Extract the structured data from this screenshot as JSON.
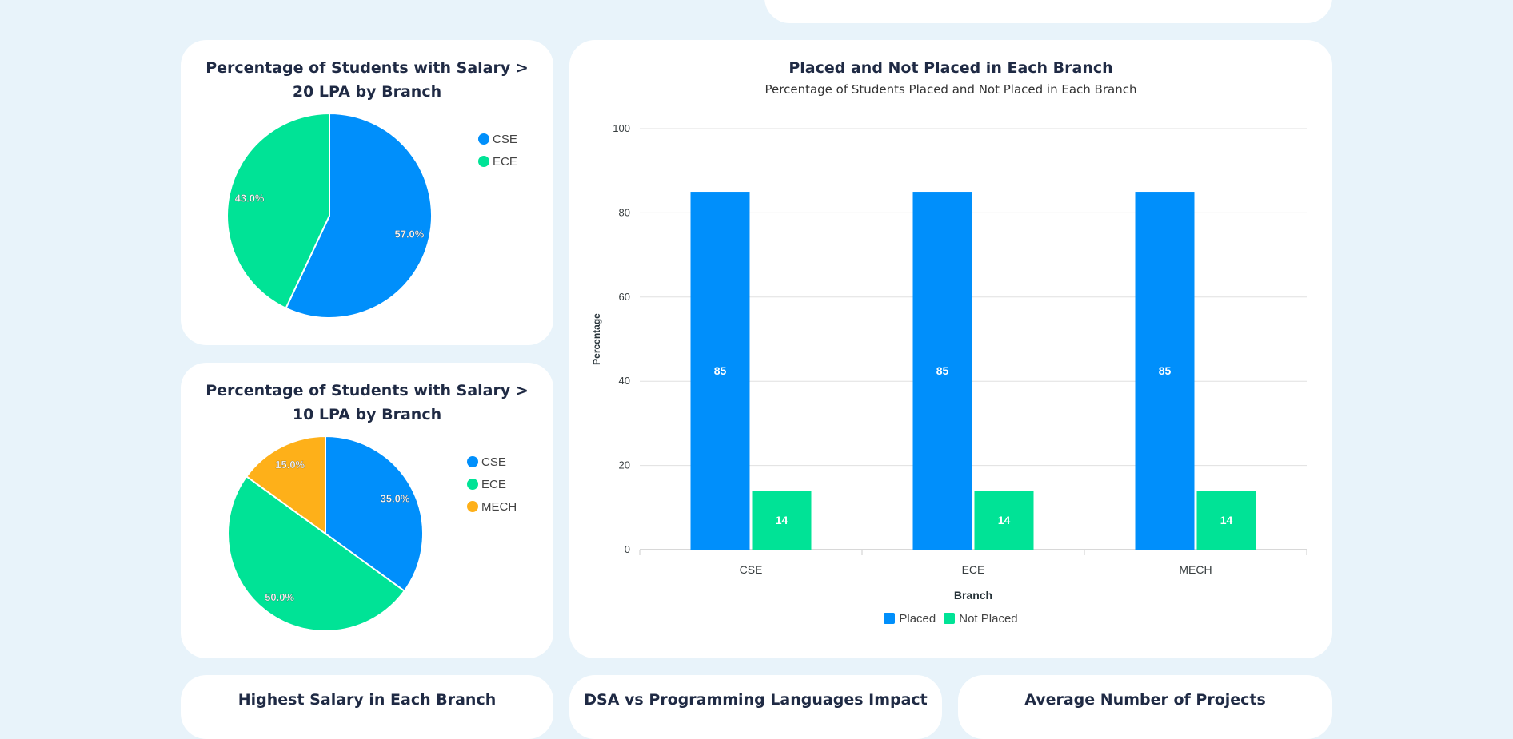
{
  "colors": {
    "blue": "#008ffb",
    "green": "#00e396",
    "orange": "#feb019",
    "bg": "#e8f3fa"
  },
  "charts": {
    "pie20": {
      "title": "Percentage of Students with Salary > 20 LPA by Branch",
      "legend": [
        "CSE",
        "ECE"
      ]
    },
    "pie10": {
      "title": "Percentage of Students with Salary > 10 LPA by Branch",
      "legend": [
        "CSE",
        "ECE",
        "MECH"
      ]
    },
    "bar": {
      "title": "Placed and Not Placed in Each Branch",
      "subtitle": "Percentage of Students Placed and Not Placed in Each Branch",
      "legend": [
        "Placed",
        "Not Placed"
      ]
    }
  },
  "bottom_cards": {
    "left": "Highest Salary in Each Branch",
    "middle": "DSA vs Programming Languages Impact",
    "right": "Average Number of Projects"
  },
  "chart_data": [
    {
      "type": "pie",
      "title": "Percentage of Students with Salary > 20 LPA by Branch",
      "labels": [
        "CSE",
        "ECE"
      ],
      "values": [
        57.0,
        43.0
      ],
      "legend": "right"
    },
    {
      "type": "pie",
      "title": "Percentage of Students with Salary > 10 LPA by Branch",
      "labels": [
        "CSE",
        "ECE",
        "MECH"
      ],
      "values": [
        35.0,
        50.0,
        15.0
      ],
      "legend": "right"
    },
    {
      "type": "bar",
      "title": "Placed and Not Placed in Each Branch",
      "subtitle": "Percentage of Students Placed and Not Placed in Each Branch",
      "categories": [
        "CSE",
        "ECE",
        "MECH"
      ],
      "series": [
        {
          "name": "Placed",
          "values": [
            85,
            85,
            85
          ]
        },
        {
          "name": "Not Placed",
          "values": [
            14,
            14,
            14
          ]
        }
      ],
      "xlabel": "Branch",
      "ylabel": "Percentage",
      "ylim": [
        0,
        100
      ],
      "yticks": [
        0,
        20,
        40,
        60,
        80,
        100
      ],
      "grid": true,
      "legend": "bottom"
    }
  ]
}
